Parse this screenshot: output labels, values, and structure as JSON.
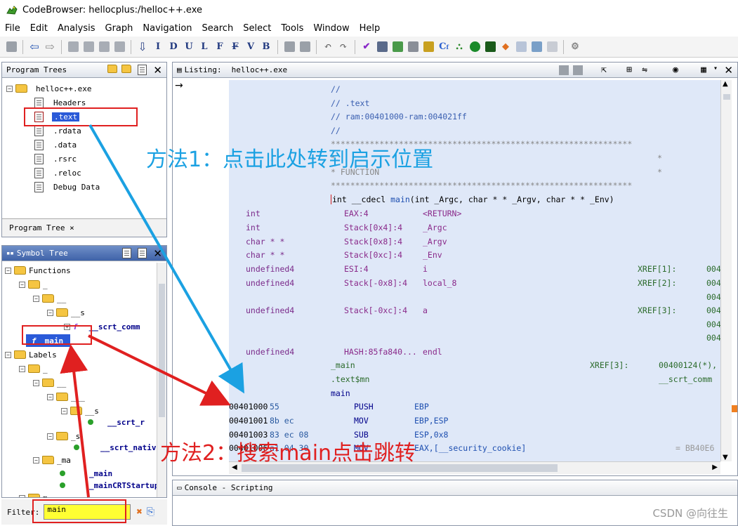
{
  "window": {
    "title": "CodeBrowser: hellocplus:/helloc++.exe"
  },
  "menu": [
    "File",
    "Edit",
    "Analysis",
    "Graph",
    "Navigation",
    "Search",
    "Select",
    "Tools",
    "Window",
    "Help"
  ],
  "toolbar": {
    "letters": [
      "I",
      "D",
      "U",
      "L",
      "F",
      "V",
      "B"
    ]
  },
  "program_trees": {
    "title": "Program Trees",
    "root": "helloc++.exe",
    "items": [
      "Headers",
      ".text",
      ".rdata",
      ".data",
      ".rsrc",
      ".reloc",
      "Debug Data"
    ],
    "tab": "Program Tree ×"
  },
  "symbol_tree": {
    "title": "Symbol Tree",
    "functions": "Functions",
    "f_underscore": "_",
    "f_dunder": "__",
    "f_s": "__s",
    "f_scrt": "__scrt_comm",
    "f_main": "main",
    "labels": "Labels",
    "l_underscore": "_",
    "l_dunder": "__",
    "l_triple": "___",
    "l_s1": "__s",
    "l_scrt_r": "__scrt_r",
    "l_s2": "_s",
    "l_scrt_nativ": "__scrt_nativ",
    "l_ma": "_ma",
    "l_main": "_main",
    "l_mainCRT": "_mainCRTStartup",
    "l_m": "m"
  },
  "filter": {
    "label": "Filter:",
    "value": "main"
  },
  "listing": {
    "title": "Listing:",
    "file": "helloc++.exe",
    "lines": {
      "c1": "//",
      "c2": "// .text",
      "c3": "// ram:00401000-ram:004021ff",
      "c4": "//",
      "stars": "**************************************************************",
      "star_edge": "*",
      "function": "*  FUNCTION",
      "sig_int": "int",
      "sig_rest": " __cdecl ",
      "sig_main": "main",
      "sig_args": "(int _Argc, char * * _Argv, char * * _Env)",
      "ret_label": "<RETURN>",
      "endl": "endl",
      "hash": "HASH:85fa840...",
      "lbl_main": "_main",
      "lbl_textmn": ".text$mn",
      "lbl_main2": "main",
      "xref_main": "XREF[3]:",
      "xref_main_addr": "00400124(*),",
      "xref_scrt": "__scrt_comm"
    },
    "vars": [
      {
        "type": "int",
        "storage": "EAX:4",
        "name": "<RETURN>"
      },
      {
        "type": "int",
        "storage": "Stack[0x4]:4",
        "name": "_Argc"
      },
      {
        "type": "char * *",
        "storage": "Stack[0x8]:4",
        "name": "_Argv"
      },
      {
        "type": "char * *",
        "storage": "Stack[0xc]:4",
        "name": "_Env"
      },
      {
        "type": "undefined4",
        "storage": "ESI:4",
        "name": "i",
        "xref": "XREF[1]:",
        "xaddr": "004"
      },
      {
        "type": "undefined4",
        "storage": "Stack[-0x8]:4",
        "name": "local_8",
        "xref": "XREF[2]:",
        "xaddr": "004"
      },
      {
        "type": "undefined4",
        "storage": "Stack[-0xc]:4",
        "name": "a",
        "xref": "XREF[3]:",
        "xaddr": "004"
      }
    ],
    "xaddr_extra": "004",
    "code": [
      {
        "addr": "00401000",
        "bytes": "55",
        "mnem": "PUSH",
        "ops": "EBP"
      },
      {
        "addr": "00401001",
        "bytes": "8b ec",
        "mnem": "MOV",
        "ops": "EBP,ESP"
      },
      {
        "addr": "00401003",
        "bytes": "83 ec 08",
        "mnem": "SUB",
        "ops": "ESP,0x8"
      },
      {
        "addr": "00401006",
        "bytes": "a1 04 30",
        "mnem": "MOV",
        "ops": "EAX,[__security_cookie]"
      }
    ],
    "cookie_value": "= BB40E6"
  },
  "console": {
    "title": "Console - Scripting"
  },
  "annotations": {
    "method1": "方法1：点击此处转到启示位置",
    "method2": "方法2：搜索main点击跳转"
  },
  "watermark": "CSDN @向往生",
  "colors": {
    "arrow_blue": "#1ba1e2",
    "arrow_red": "#e02020",
    "listing_bg": "#dfe8f8"
  }
}
